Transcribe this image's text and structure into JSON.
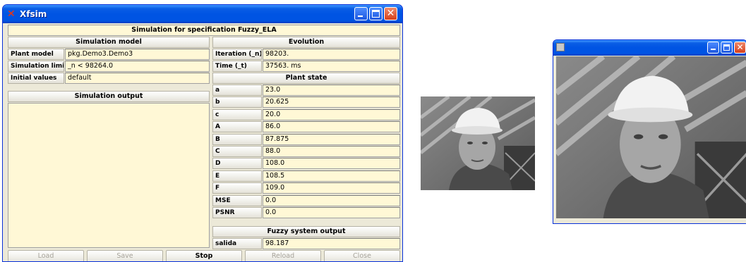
{
  "window": {
    "title": "Xfsim",
    "spec_header": "Simulation for specification Fuzzy_ELA"
  },
  "simulation_model": {
    "header": "Simulation model",
    "rows": [
      {
        "label": "Plant model",
        "value": "pkg.Demo3.Demo3"
      },
      {
        "label": "Simulation limit",
        "value": "_n < 98264.0"
      },
      {
        "label": "Initial values",
        "value": "default"
      }
    ]
  },
  "simulation_output": {
    "header": "Simulation output"
  },
  "evolution": {
    "header": "Evolution",
    "rows": [
      {
        "label": "Iteration (_n)",
        "value": "98203."
      },
      {
        "label": "Time (_t)",
        "value": "37563. ms"
      }
    ]
  },
  "plant_state": {
    "header": "Plant state",
    "rows": [
      {
        "label": "a",
        "value": "23.0"
      },
      {
        "label": "b",
        "value": "20.625"
      },
      {
        "label": "c",
        "value": "20.0"
      },
      {
        "label": "A",
        "value": "86.0"
      },
      {
        "label": "B",
        "value": "87.875"
      },
      {
        "label": "C",
        "value": "88.0"
      },
      {
        "label": "D",
        "value": "108.0"
      },
      {
        "label": "E",
        "value": "108.5"
      },
      {
        "label": "F",
        "value": "109.0"
      },
      {
        "label": "MSE",
        "value": "0.0"
      },
      {
        "label": "PSNR",
        "value": "0.0"
      }
    ]
  },
  "fuzzy_output": {
    "header": "Fuzzy system output",
    "rows": [
      {
        "label": "salida",
        "value": "98.187"
      }
    ]
  },
  "buttons": [
    {
      "label": "Load",
      "enabled": false
    },
    {
      "label": "Save",
      "enabled": false
    },
    {
      "label": "Stop",
      "enabled": true
    },
    {
      "label": "Reload",
      "enabled": false
    },
    {
      "label": "Close",
      "enabled": false
    }
  ],
  "colors": {
    "titlebar": "#0054e3",
    "field_bg": "#fff8d6",
    "panel_bg": "#ece9d8",
    "close_button": "#d6401b"
  },
  "thumbnail": {
    "subject": "grayscale photo of man in white hard hat"
  },
  "image_window": {
    "subject": "enlarged grayscale photo of man in white hard hat"
  }
}
